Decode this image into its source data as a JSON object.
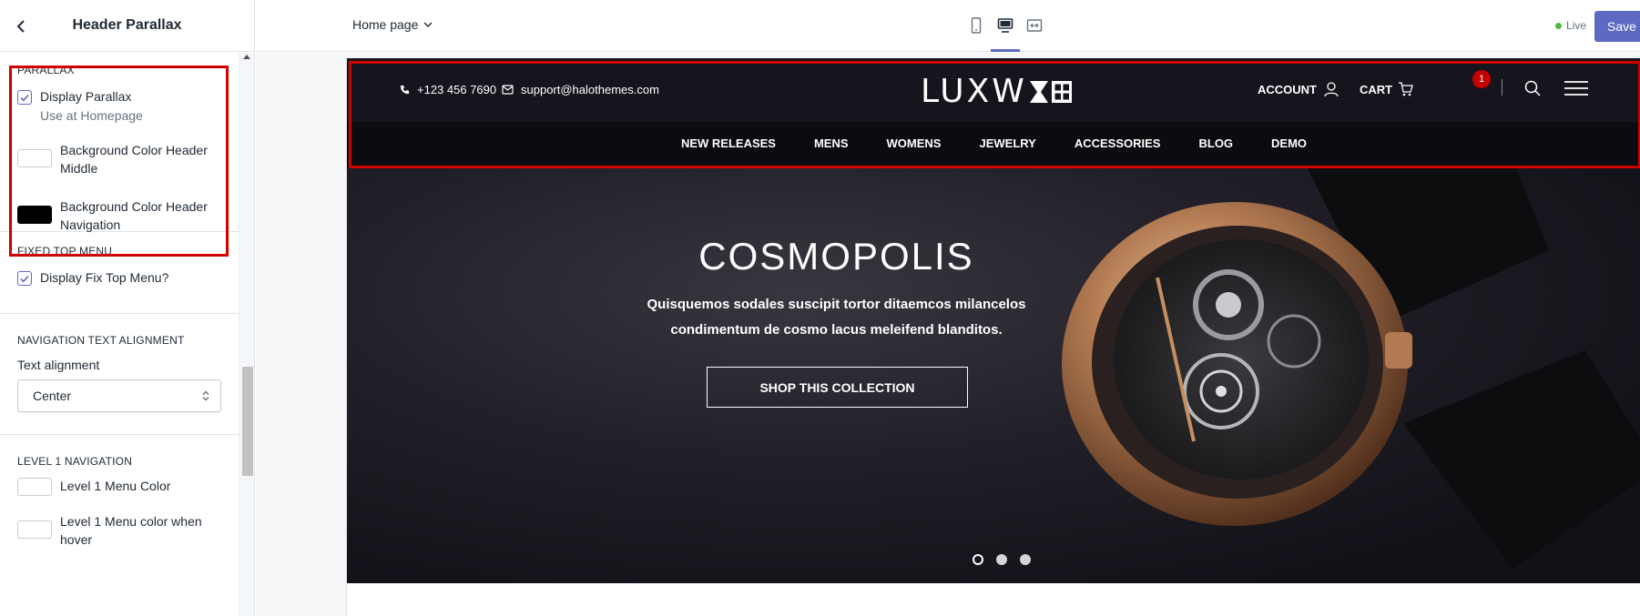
{
  "sidebar": {
    "title": "Header Parallax",
    "sections": {
      "parallax": {
        "heading": "PARALLAX",
        "display_label": "Display Parallax",
        "hint": "Use at Homepage",
        "bg_middle_label": "Background Color Header Middle",
        "bg_middle_color": "#ffffff",
        "bg_nav_label": "Background Color Header Navigation",
        "bg_nav_color": "#000000"
      },
      "fixed_top": {
        "heading": "FIXED TOP MENU",
        "display_label": "Display Fix Top Menu?"
      },
      "nav_align": {
        "heading": "NAVIGATION TEXT ALIGNMENT",
        "field_label": "Text alignment",
        "selected": "Center"
      },
      "level1": {
        "heading": "LEVEL 1 NAVIGATION",
        "menu_color_label": "Level 1 Menu Color",
        "menu_hover_label": "Level 1 Menu color when hover"
      }
    }
  },
  "topbar": {
    "page": "Home page",
    "status": "Live",
    "save": "Save"
  },
  "store": {
    "phone": "+123 456 7690",
    "email": "support@halothemes.com",
    "logo": "LUXW",
    "account": "ACCOUNT",
    "cart": "CART",
    "cart_count": "1",
    "nav": [
      "NEW RELEASES",
      "MENS",
      "WOMENS",
      "JEWELRY",
      "ACCESSORIES",
      "BLOG",
      "DEMO"
    ],
    "hero": {
      "title": "COSMOPOLIS",
      "subtitle": "Quisquemos sodales suscipit tortor ditaemcos milancelos condimentum de cosmo lacus meleifend blanditos.",
      "button": "SHOP THIS COLLECTION"
    },
    "slides_total": 3,
    "slide_active": 1
  },
  "colors": {
    "accent": "#5c6ac4",
    "highlight": "#d10000",
    "header_bg": "#16141c",
    "badge": "#c40000"
  }
}
